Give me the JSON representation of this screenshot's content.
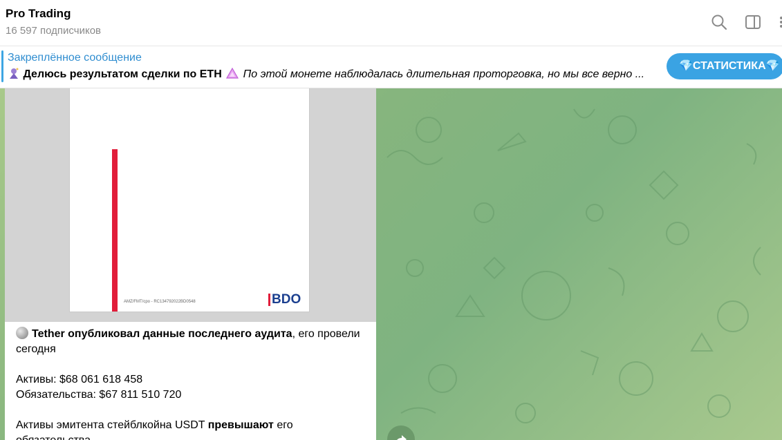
{
  "header": {
    "title": "Pro Trading",
    "subscribers": "16 597 подписчиков",
    "icons": [
      "search-icon",
      "sidebar-toggle-icon",
      "more-icon"
    ]
  },
  "pinned": {
    "label": "Закреплённое сообщение",
    "title": "Делюсь результатом сделки по ETH",
    "preview": "По этой монете наблюдалась длительная проторговка, но мы все верно ...",
    "button": "💎СТАТИСТИКА💎",
    "accent_color": "#3ea6e3"
  },
  "message": {
    "document": {
      "ref": "AMZ/FMT/cpo - RC134792022BD0548",
      "logo": "BDO"
    },
    "line1_bold": "Tether опубликовал данные последнего аудита",
    "line1_rest": ", его провели сегодня",
    "assets": "Активы:  $68 061 618 458",
    "liabilities": "Обязательства: $67 811 510 720",
    "summary_start": "Активы эмитента стейблкойна USDT ",
    "summary_bold": "превышают",
    "summary_end": " его обязательства"
  }
}
